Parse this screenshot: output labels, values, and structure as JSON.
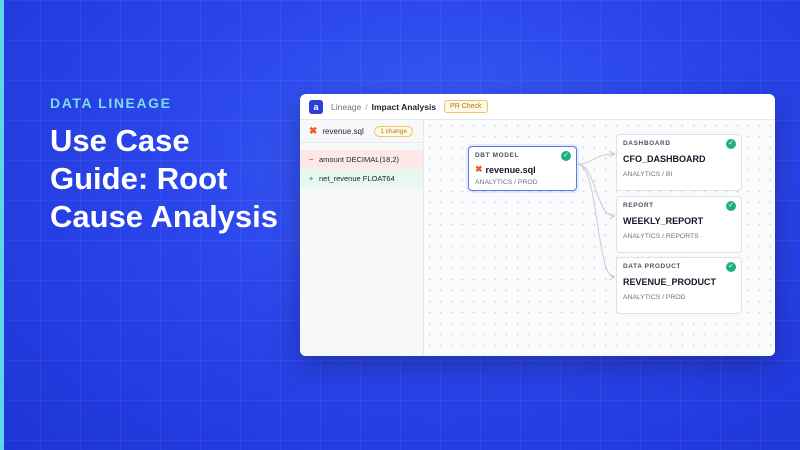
{
  "slide": {
    "eyebrow": "DATA LINEAGE",
    "headline": "Use Case Guide: Root Cause Analysis"
  },
  "app": {
    "logo_letter": "a",
    "breadcrumb": [
      "Lineage",
      "Impact Analysis"
    ],
    "pr_badge": "PR Check"
  },
  "sidebar": {
    "file": "revenue.sql",
    "change_count": "1 change",
    "changes": [
      {
        "sign": "−",
        "text": "amount DECIMAL(18,2)",
        "kind": "removed"
      },
      {
        "sign": "+",
        "text": "net_revenue FLOAT64",
        "kind": "added"
      }
    ]
  },
  "graph": {
    "source": {
      "type": "DBT MODEL",
      "name": "revenue.sql",
      "path": "ANALYTICS / PROD"
    },
    "targets": [
      {
        "type": "DASHBOARD",
        "name": "CFO_DASHBOARD",
        "path": "ANALYTICS / BI"
      },
      {
        "type": "REPORT",
        "name": "WEEKLY_REPORT",
        "path": "ANALYTICS / REPORTS"
      },
      {
        "type": "DATA PRODUCT",
        "name": "REVENUE_PRODUCT",
        "path": "ANALYTICS / PROD"
      }
    ],
    "status_icon": "check-circle-icon",
    "dbt_icon": "dbt-logo-icon"
  },
  "colors": {
    "background": "#2a45ea",
    "accent": "#7fdcec",
    "source_border": "#5b7be6",
    "status_ok": "#22b07d",
    "removed": "#d9534f",
    "added": "#2bb673",
    "dbt": "#f05a28"
  }
}
